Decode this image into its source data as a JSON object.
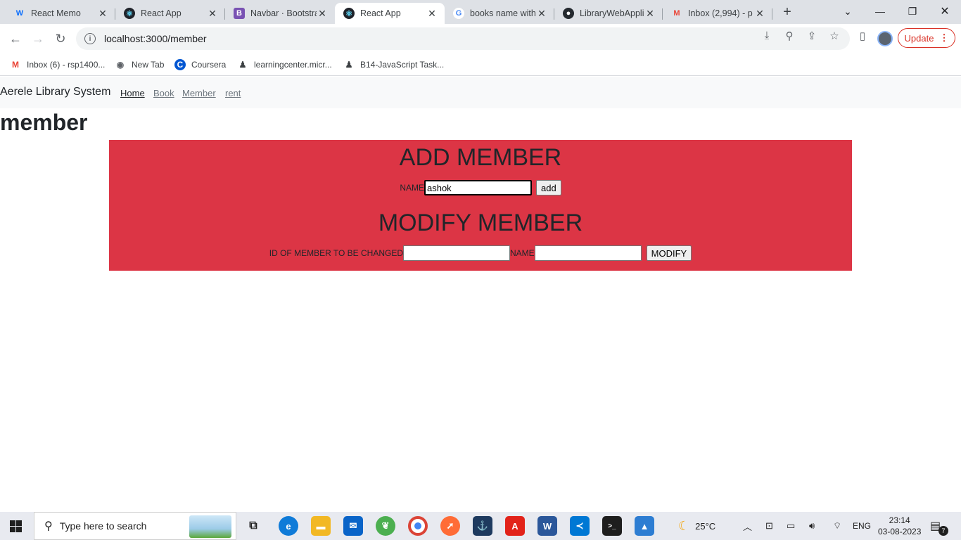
{
  "browser": {
    "tabs": [
      {
        "label": "React Memo",
        "icon": "wix-icon",
        "glyph": "W",
        "color": "#0c6efc",
        "active": false
      },
      {
        "label": "React App",
        "icon": "react-icon",
        "glyph": "⚛",
        "color": "#20232a",
        "active": false
      },
      {
        "label": "Navbar · Bootstra",
        "icon": "bootstrap-icon",
        "glyph": "B",
        "color": "#7952b3",
        "active": false
      },
      {
        "label": "React App",
        "icon": "react-icon",
        "glyph": "⚛",
        "color": "#20232a",
        "active": true
      },
      {
        "label": "books name with",
        "icon": "google-icon",
        "glyph": "G",
        "color": "#4285f4",
        "active": false
      },
      {
        "label": "LibraryWebApplic",
        "icon": "github-icon",
        "glyph": "●",
        "color": "#24292f",
        "active": false
      },
      {
        "label": "Inbox (2,994) - p",
        "icon": "gmail-icon",
        "glyph": "M",
        "color": "#ea4335",
        "active": false
      }
    ],
    "new_tab": "+",
    "url": "localhost:3000/member",
    "update_label": "Update",
    "bookmarks": [
      {
        "label": "Inbox (6) - rsp1400...",
        "icon": "gmail-icon",
        "glyph": "M",
        "color": "#ea4335"
      },
      {
        "label": "New Tab",
        "icon": "globe-icon",
        "glyph": "◉",
        "color": "#5f6368"
      },
      {
        "label": "Coursera",
        "icon": "coursera-icon",
        "glyph": "C",
        "color": "#0056d2"
      },
      {
        "label": "learningcenter.micr...",
        "icon": "person-icon",
        "glyph": "♟",
        "color": "#3c4043"
      },
      {
        "label": "B14-JavaScript Task...",
        "icon": "person-icon",
        "glyph": "♟",
        "color": "#3c4043"
      }
    ]
  },
  "app": {
    "brand": "Aerele Library System",
    "nav": [
      {
        "label": "Home",
        "active": true
      },
      {
        "label": "Book",
        "active": false
      },
      {
        "label": "Member",
        "active": false
      },
      {
        "label": "rent",
        "active": false
      }
    ],
    "heading": "member",
    "add_section": {
      "title": "ADD MEMBER",
      "name_label": "NAME",
      "name_value": "ashok",
      "add_button": "add"
    },
    "modify_section": {
      "title": "MODIFY MEMBER",
      "id_label": "ID OF MEMBER TO BE CHANGED",
      "id_value": "",
      "name_label": "NAME",
      "name_value": "",
      "modify_button": "MODIFY"
    },
    "panel_color": "#dc3545"
  },
  "taskbar": {
    "search_placeholder": "Type here to search",
    "weather": "25°C",
    "language": "ENG",
    "time": "23:14",
    "date": "03-08-2023",
    "notification_count": "7"
  }
}
